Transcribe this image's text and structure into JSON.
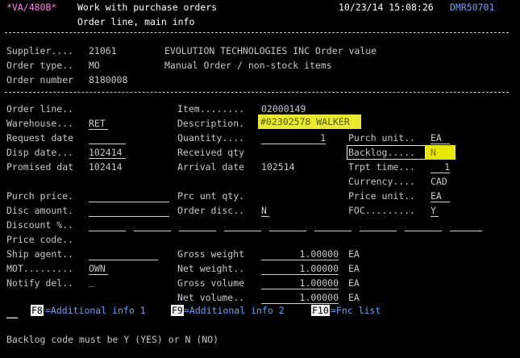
{
  "header": {
    "program": "*VA/480B*",
    "title": "Work with purchase orders",
    "subtitle": "Order line, main info",
    "datetime": "10/23/14 15:08:26",
    "device": "DMR50701"
  },
  "order": {
    "supplier_label": "Supplier.... ",
    "supplier_value": "21061",
    "supplier_name": "EVOLUTION TECHNOLOGIES INC Order value",
    "order_type_label": "Order type.. ",
    "order_type_value": "MO",
    "order_type_desc": "Manual Order / non-stock items",
    "order_number_label": "Order number ",
    "order_number_value": "8180008"
  },
  "left": {
    "order_line": "Order line..",
    "warehouse": "Warehouse...",
    "warehouse_value": "RET",
    "request_date": "Request date",
    "disp_date": "Disp date...",
    "disp_date_value": "102414",
    "promised": "Promised dat",
    "promised_value": "102414",
    "purch_price": "Purch price.",
    "disc_amount": "Disc amount.",
    "discount_pct": "Discount %..",
    "price_code": "Price code..",
    "ship_agent": "Ship agent..",
    "mot": "MOT.........",
    "mot_value": "OWN",
    "notify_del": "Notify del..",
    "notify_del_value": "_"
  },
  "middle": {
    "item_label": "Item........",
    "item_value": "02000149",
    "description_label": "Description.",
    "description_value": "#02302578 WALKER",
    "quantity_label": "Quantity....",
    "quantity_value": "1",
    "received_qty": "Received qty",
    "arrival_label": "Arrival date",
    "arrival_value": "102514",
    "prc_unt_qty": "Prc unt qty.",
    "order_disc_label": "Order disc..",
    "order_disc_value": "N",
    "gross_weight_label": "Gross weight",
    "gross_weight_value": "1.00000",
    "net_weight_label": "Net weight..",
    "net_weight_value": "1.00000",
    "gross_volume_label": "Gross volume",
    "gross_volume_value": "1.00000",
    "net_volume_label": "Net volume..",
    "net_volume_value": "1.00000",
    "unit": "EA"
  },
  "right": {
    "purch_unit_label": "Purch unit..",
    "purch_unit_value": "EA",
    "backlog_label": "Backlog.....",
    "backlog_value": "N",
    "trpt_time_label": "Trpt time...",
    "trpt_time_value": "1",
    "currency_label": "Currency....",
    "currency_value": "CAD",
    "price_unit_label": "Price unit..",
    "price_unit_value": "EA",
    "foc_label": "FOC.........",
    "foc_value": "Y"
  },
  "fkeys": {
    "f8_key": "F8",
    "f8_label": "=Additional info 1",
    "f9_key": "F9",
    "f9_label": "=Additional info 2",
    "f10_key": "F10",
    "f10_label": "=Fnc list",
    "cmd_value": "__"
  },
  "message": "Backlog code must be Y (YES) or N (NO)",
  "colors": {
    "background": "#000000",
    "text": "#c8c8c8",
    "title": "#ffffff",
    "fkey_text": "#6fa0ff",
    "device": "#ff7de8",
    "highlight": "#eaea2a"
  }
}
